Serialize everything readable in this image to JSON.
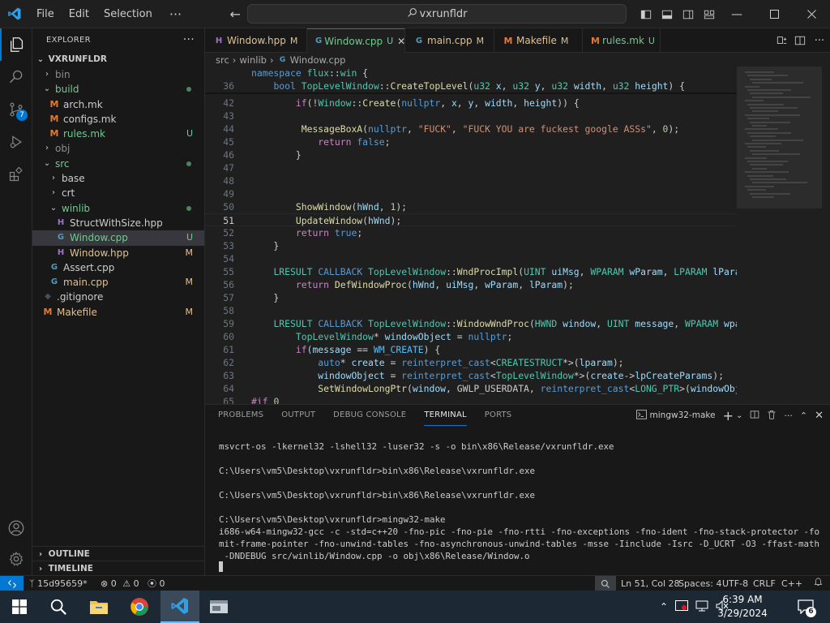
{
  "titlebar": {
    "menus": [
      "File",
      "Edit",
      "Selection"
    ],
    "more": "···",
    "search_text": "vxrunfldr"
  },
  "activity": {
    "source_control_badge": "7"
  },
  "sidebar": {
    "header": "EXPLORER",
    "more": "···",
    "folder": "VXRUNFLDR",
    "items": [
      {
        "label": "bin",
        "type": "folder",
        "open": false,
        "indent": 1,
        "badge": "",
        "dim": true
      },
      {
        "label": "build",
        "type": "folder",
        "open": true,
        "indent": 1,
        "badge": "dot",
        "mod": "untracked"
      },
      {
        "label": "arch.mk",
        "type": "m",
        "indent": 2,
        "badge": ""
      },
      {
        "label": "configs.mk",
        "type": "m",
        "indent": 2,
        "badge": ""
      },
      {
        "label": "rules.mk",
        "type": "m",
        "indent": 2,
        "badge": "U",
        "mod": "untracked"
      },
      {
        "label": "obj",
        "type": "folder",
        "open": false,
        "indent": 1,
        "badge": "",
        "dim": true
      },
      {
        "label": "src",
        "type": "folder",
        "open": true,
        "indent": 1,
        "badge": "dot",
        "mod": "untracked"
      },
      {
        "label": "base",
        "type": "folder",
        "open": false,
        "indent": 2,
        "badge": ""
      },
      {
        "label": "crt",
        "type": "folder",
        "open": false,
        "indent": 2,
        "badge": ""
      },
      {
        "label": "winlib",
        "type": "folder",
        "open": true,
        "indent": 2,
        "badge": "dot",
        "mod": "untracked"
      },
      {
        "label": "StructWithSize.hpp",
        "type": "h",
        "indent": 3,
        "badge": ""
      },
      {
        "label": "Window.cpp",
        "type": "c",
        "indent": 3,
        "badge": "U",
        "mod": "untracked",
        "selected": true
      },
      {
        "label": "Window.hpp",
        "type": "h",
        "indent": 3,
        "badge": "M",
        "mod": "modified"
      },
      {
        "label": "Assert.cpp",
        "type": "c",
        "indent": 2,
        "badge": ""
      },
      {
        "label": "main.cpp",
        "type": "c",
        "indent": 2,
        "badge": "M",
        "mod": "modified"
      },
      {
        "label": ".gitignore",
        "type": "g",
        "indent": 1,
        "badge": ""
      },
      {
        "label": "Makefile",
        "type": "m",
        "indent": 1,
        "badge": "M",
        "mod": "modified"
      }
    ],
    "outline": "OUTLINE",
    "timeline": "TIMELINE"
  },
  "tabs": [
    {
      "label": "Window.hpp",
      "status": "M",
      "icon": "h",
      "mod": "modified",
      "active": false
    },
    {
      "label": "Window.cpp",
      "status": "U",
      "icon": "c",
      "mod": "untracked",
      "active": true
    },
    {
      "label": "main.cpp",
      "status": "M",
      "icon": "c",
      "mod": "modified",
      "active": false
    },
    {
      "label": "Makefile",
      "status": "M",
      "icon": "m",
      "mod": "modified",
      "active": false
    },
    {
      "label": "rules.mk",
      "status": "U",
      "icon": "m",
      "mod": "untracked",
      "active": false
    }
  ],
  "breadcrumb": [
    "src",
    "winlib",
    "Window.cpp"
  ],
  "code": [
    {
      "n": "",
      "sticky": true,
      "t": [
        [
          "namespace ",
          "kw"
        ],
        [
          "flux",
          "ty"
        ],
        [
          "::",
          "p"
        ],
        [
          "win",
          "ty"
        ],
        [
          " {",
          "p"
        ]
      ]
    },
    {
      "n": "36",
      "sticky": true,
      "t": [
        [
          "    ",
          "p"
        ],
        [
          "bool ",
          "kw"
        ],
        [
          "TopLevelWindow",
          "ty"
        ],
        [
          "::",
          "p"
        ],
        [
          "CreateTopLevel",
          "fn"
        ],
        [
          "(",
          "p"
        ],
        [
          "u32 ",
          "ty"
        ],
        [
          "x",
          "va"
        ],
        [
          ", ",
          "p"
        ],
        [
          "u32 ",
          "ty"
        ],
        [
          "y",
          "va"
        ],
        [
          ", ",
          "p"
        ],
        [
          "u32 ",
          "ty"
        ],
        [
          "width",
          "va"
        ],
        [
          ", ",
          "p"
        ],
        [
          "u32 ",
          "ty"
        ],
        [
          "height",
          "va"
        ],
        [
          ") {",
          "p"
        ]
      ]
    },
    {
      "n": "42",
      "t": [
        [
          "        ",
          "p"
        ],
        [
          "if",
          "ctl"
        ],
        [
          "(!",
          "p"
        ],
        [
          "Window",
          "ty"
        ],
        [
          "::",
          "p"
        ],
        [
          "Create",
          "fn"
        ],
        [
          "(",
          "p"
        ],
        [
          "nullptr",
          "kw"
        ],
        [
          ", ",
          "p"
        ],
        [
          "x",
          "va"
        ],
        [
          ", ",
          "p"
        ],
        [
          "y",
          "va"
        ],
        [
          ", ",
          "p"
        ],
        [
          "width",
          "va"
        ],
        [
          ", ",
          "p"
        ],
        [
          "height",
          "va"
        ],
        [
          ")) {",
          "p"
        ]
      ]
    },
    {
      "n": "43",
      "t": []
    },
    {
      "n": "44",
      "t": [
        [
          "         ",
          "p"
        ],
        [
          "MessageBoxA",
          "fn"
        ],
        [
          "(",
          "p"
        ],
        [
          "nullptr",
          "kw"
        ],
        [
          ", ",
          "p"
        ],
        [
          "\"FUCK\"",
          "str"
        ],
        [
          ", ",
          "p"
        ],
        [
          "\"FUCK YOU are fuckest google ASSs\"",
          "str"
        ],
        [
          ", ",
          "p"
        ],
        [
          "0",
          "num"
        ],
        [
          ");",
          "p"
        ]
      ]
    },
    {
      "n": "45",
      "t": [
        [
          "            ",
          "p"
        ],
        [
          "return ",
          "ctl"
        ],
        [
          "false",
          "kw"
        ],
        [
          ";",
          "p"
        ]
      ]
    },
    {
      "n": "46",
      "t": [
        [
          "        }",
          "p"
        ]
      ]
    },
    {
      "n": "47",
      "t": []
    },
    {
      "n": "48",
      "t": []
    },
    {
      "n": "49",
      "t": []
    },
    {
      "n": "50",
      "t": [
        [
          "        ",
          "p"
        ],
        [
          "ShowWindow",
          "fn"
        ],
        [
          "(",
          "p"
        ],
        [
          "hWnd",
          "va"
        ],
        [
          ", ",
          "p"
        ],
        [
          "1",
          "num"
        ],
        [
          ");",
          "p"
        ]
      ]
    },
    {
      "n": "51",
      "cur": true,
      "t": [
        [
          "        ",
          "p"
        ],
        [
          "UpdateWindow",
          "fn"
        ],
        [
          "(",
          "p"
        ],
        [
          "hWnd",
          "va"
        ],
        [
          ");",
          "p"
        ]
      ]
    },
    {
      "n": "52",
      "t": [
        [
          "        ",
          "p"
        ],
        [
          "return ",
          "ctl"
        ],
        [
          "true",
          "kw"
        ],
        [
          ";",
          "p"
        ]
      ]
    },
    {
      "n": "53",
      "t": [
        [
          "    }",
          "p"
        ]
      ]
    },
    {
      "n": "54",
      "t": []
    },
    {
      "n": "55",
      "t": [
        [
          "    ",
          "p"
        ],
        [
          "LRESULT ",
          "ty"
        ],
        [
          "CALLBACK ",
          "kw"
        ],
        [
          "TopLevelWindow",
          "ty"
        ],
        [
          "::",
          "p"
        ],
        [
          "WndProcImpl",
          "fn"
        ],
        [
          "(",
          "p"
        ],
        [
          "UINT ",
          "ty"
        ],
        [
          "uiMsg",
          "va"
        ],
        [
          ", ",
          "p"
        ],
        [
          "WPARAM ",
          "ty"
        ],
        [
          "wParam",
          "va"
        ],
        [
          ", ",
          "p"
        ],
        [
          "LPARAM ",
          "ty"
        ],
        [
          "lParam",
          "va"
        ],
        [
          ") {",
          "p"
        ]
      ]
    },
    {
      "n": "56",
      "t": [
        [
          "        ",
          "p"
        ],
        [
          "return ",
          "ctl"
        ],
        [
          "DefWindowProc",
          "fn"
        ],
        [
          "(",
          "p"
        ],
        [
          "hWnd",
          "va"
        ],
        [
          ", ",
          "p"
        ],
        [
          "uiMsg",
          "va"
        ],
        [
          ", ",
          "p"
        ],
        [
          "wParam",
          "va"
        ],
        [
          ", ",
          "p"
        ],
        [
          "lParam",
          "va"
        ],
        [
          ");",
          "p"
        ]
      ]
    },
    {
      "n": "57",
      "t": [
        [
          "    }",
          "p"
        ]
      ]
    },
    {
      "n": "58",
      "t": []
    },
    {
      "n": "59",
      "t": [
        [
          "    ",
          "p"
        ],
        [
          "LRESULT ",
          "ty"
        ],
        [
          "CALLBACK ",
          "kw"
        ],
        [
          "TopLevelWindow",
          "ty"
        ],
        [
          "::",
          "p"
        ],
        [
          "WindowWndProc",
          "fn"
        ],
        [
          "(",
          "p"
        ],
        [
          "HWND ",
          "ty"
        ],
        [
          "window",
          "va"
        ],
        [
          ", ",
          "p"
        ],
        [
          "UINT ",
          "ty"
        ],
        [
          "message",
          "va"
        ],
        [
          ", ",
          "p"
        ],
        [
          "WPARAM ",
          "ty"
        ],
        [
          "wparam",
          "va"
        ],
        [
          ", L",
          "p"
        ]
      ]
    },
    {
      "n": "60",
      "t": [
        [
          "        ",
          "p"
        ],
        [
          "TopLevelWindow",
          "ty"
        ],
        [
          "* ",
          "p"
        ],
        [
          "windowObject",
          "va"
        ],
        [
          " = ",
          "p"
        ],
        [
          "nullptr",
          "kw"
        ],
        [
          ";",
          "p"
        ]
      ]
    },
    {
      "n": "61",
      "t": [
        [
          "        ",
          "p"
        ],
        [
          "if",
          "ctl"
        ],
        [
          "(",
          "p"
        ],
        [
          "message",
          "va"
        ],
        [
          " == ",
          "p"
        ],
        [
          "WM_CREATE",
          "mac"
        ],
        [
          ") {",
          "p"
        ]
      ]
    },
    {
      "n": "62",
      "t": [
        [
          "            ",
          "p"
        ],
        [
          "auto",
          "kw"
        ],
        [
          "* ",
          "p"
        ],
        [
          "create",
          "va"
        ],
        [
          " = ",
          "p"
        ],
        [
          "reinterpret_cast",
          "kw"
        ],
        [
          "<",
          "p"
        ],
        [
          "CREATESTRUCT",
          "ty"
        ],
        [
          "*>(",
          "p"
        ],
        [
          "lparam",
          "va"
        ],
        [
          ");",
          "p"
        ]
      ]
    },
    {
      "n": "63",
      "t": [
        [
          "            ",
          "p"
        ],
        [
          "windowObject",
          "va"
        ],
        [
          " = ",
          "p"
        ],
        [
          "reinterpret_cast",
          "kw"
        ],
        [
          "<",
          "p"
        ],
        [
          "TopLevelWindow",
          "ty"
        ],
        [
          "*>(",
          "p"
        ],
        [
          "create",
          "va"
        ],
        [
          "->",
          "p"
        ],
        [
          "lpCreateParams",
          "va"
        ],
        [
          ");",
          "p"
        ]
      ]
    },
    {
      "n": "64",
      "t": [
        [
          "            ",
          "p"
        ],
        [
          "SetWindowLongPtr",
          "fn"
        ],
        [
          "(",
          "p"
        ],
        [
          "window",
          "va"
        ],
        [
          ", GWLP_USERDATA, ",
          "p"
        ],
        [
          "reinterpret_cast",
          "kw"
        ],
        [
          "<",
          "p"
        ],
        [
          "LONG_PTR",
          "ty"
        ],
        [
          ">(",
          "p"
        ],
        [
          "windowObject",
          "va"
        ],
        [
          "));",
          "p"
        ]
      ]
    },
    {
      "n": "65",
      "t": [
        [
          "#if ",
          "ctl"
        ],
        [
          "0",
          "num"
        ]
      ]
    }
  ],
  "panel": {
    "tabs": [
      "PROBLEMS",
      "OUTPUT",
      "DEBUG CONSOLE",
      "TERMINAL",
      "PORTS"
    ],
    "active_tab": "TERMINAL",
    "terminal_name": "mingw32-make",
    "lines": [
      "msvcrt-os -lkernel32 -lshell32 -luser32 -s -o bin\\x86\\Release/vxrunfldr.exe",
      "",
      "C:\\Users\\vm5\\Desktop\\vxrunfldr>bin\\x86\\Release\\vxrunfldr.exe",
      "",
      "C:\\Users\\vm5\\Desktop\\vxrunfldr>bin\\x86\\Release\\vxrunfldr.exe",
      "",
      "C:\\Users\\vm5\\Desktop\\vxrunfldr>mingw32-make",
      "i686-w64-mingw32-gcc -c -std=c++20 -fno-pic -fno-pie -fno-rtti -fno-exceptions -fno-ident -fno-stack-protector -fo",
      "mit-frame-pointer -fno-unwind-tables -fno-asynchronous-unwind-tables -msse -Iinclude -Isrc -D_UCRT -O3 -ffast-math",
      " -DNDEBUG src/winlib/Window.cpp -o obj\\x86\\Release/Window.o"
    ]
  },
  "status": {
    "branch": "15d95659*",
    "errors": "0",
    "warnings": "0",
    "ports": "0",
    "position": "Ln 51, Col 28",
    "spaces": "Spaces: 4",
    "encoding": "UTF-8",
    "eol": "CRLF",
    "language": "C++"
  },
  "taskbar": {
    "time": "6:39 AM",
    "date": "3/29/2024",
    "notifications": "6"
  },
  "colors": {
    "accent": "#0078d4",
    "modified": "#e2c08d",
    "untracked": "#73c991"
  }
}
